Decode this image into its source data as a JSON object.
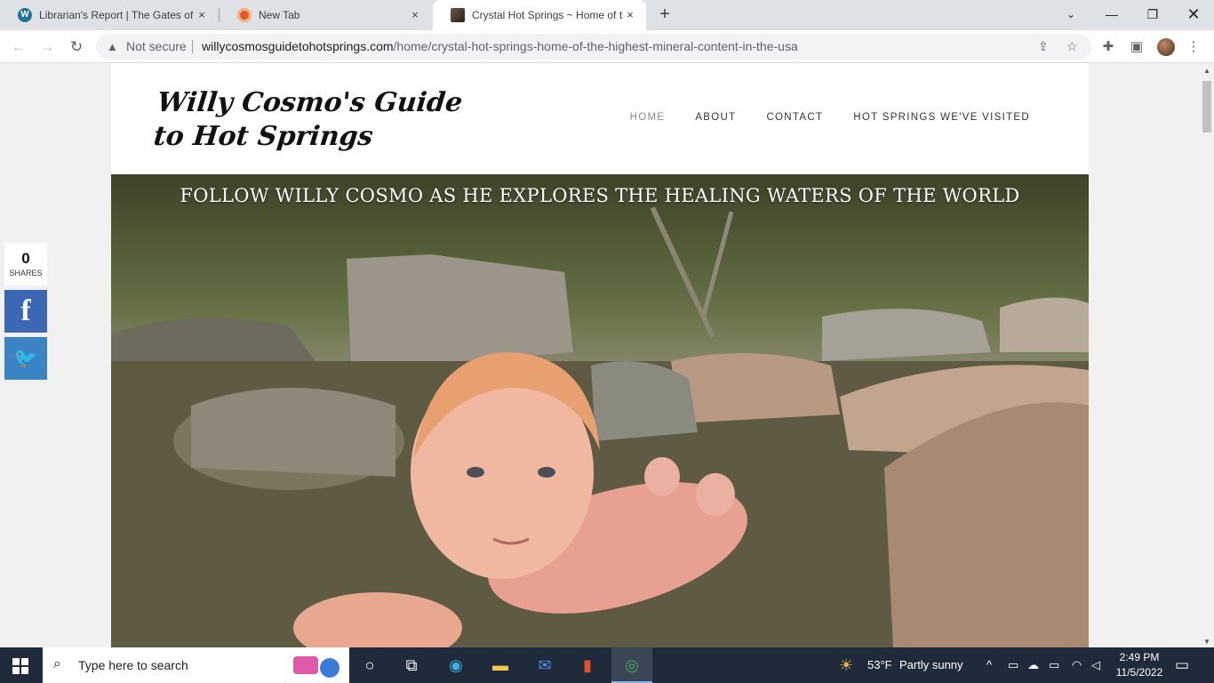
{
  "browser": {
    "tabs": [
      {
        "title": "Librarian's Report | The Gates of I",
        "icon": "wordpress-icon",
        "active": false
      },
      {
        "title": "New Tab",
        "icon": "duckduckgo-icon",
        "active": false
      },
      {
        "title": "Crystal Hot Springs ~ Home of th",
        "icon": "site-favicon-icon",
        "active": true
      }
    ],
    "new_tab": "+",
    "close_glyph": "×",
    "security_label": "Not secure",
    "url_host": "willycosmosguidetohotsprings.com",
    "url_path": "/home/crystal-hot-springs-home-of-the-highest-mineral-content-in-the-usa"
  },
  "site": {
    "title": "Willy Cosmo's Guide to Hot Springs",
    "menu": [
      "HOME",
      "ABOUT",
      "CONTACT",
      "HOT SPRINGS WE'VE VISITED"
    ],
    "hero_tagline": "FOLLOW WILLY COSMO AS HE EXPLORES THE HEALING WATERS OF THE WORLD"
  },
  "share": {
    "count": "0",
    "label": "SHARES",
    "facebook_glyph": "f",
    "twitter_glyph": "🐦"
  },
  "taskbar": {
    "search_placeholder": "Type here to search",
    "weather_temp": "53°F",
    "weather_text": "Partly sunny",
    "time": "2:49 PM",
    "date": "11/5/2022"
  },
  "colors": {
    "facebook": "#3b68b4",
    "twitter": "#3a83c4",
    "menu_current": "#8b8b8b"
  }
}
